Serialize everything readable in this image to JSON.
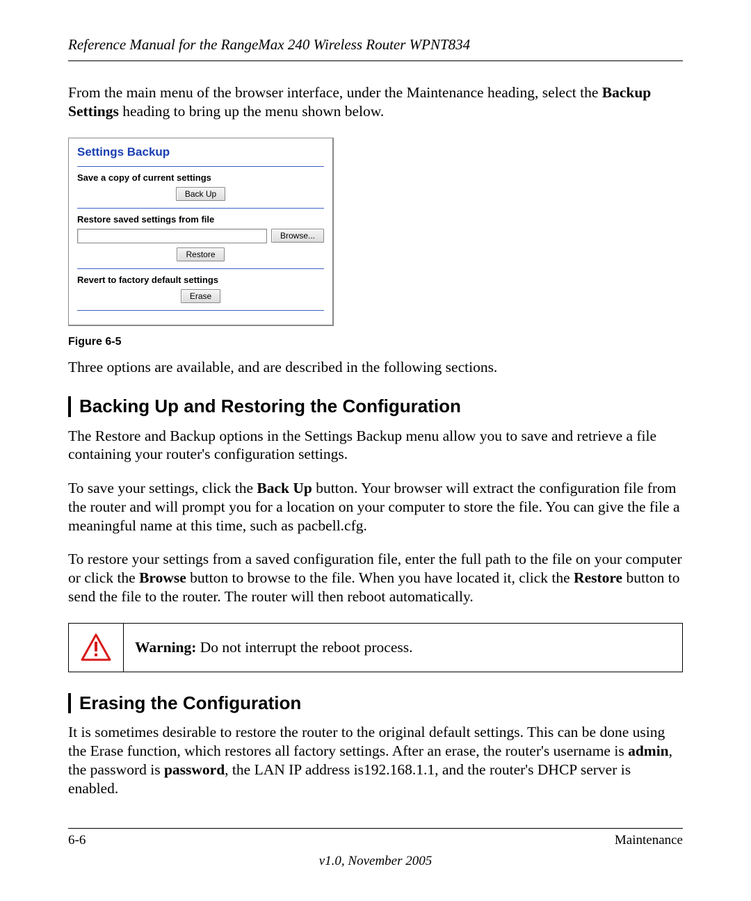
{
  "header": {
    "running_head": "Reference Manual for the RangeMax 240 Wireless Router WPNT834"
  },
  "intro": {
    "pre": "From the main menu of the browser interface, under the Maintenance heading, select the ",
    "bold1": "Backup Settings",
    "post": " heading to bring up the menu shown below."
  },
  "panel": {
    "title": "Settings Backup",
    "save_label": "Save a copy of current settings",
    "backup_btn": "Back Up",
    "restore_label": "Restore saved settings from file",
    "browse_btn": "Browse...",
    "restore_btn": "Restore",
    "revert_label": "Revert to factory default settings",
    "erase_btn": "Erase",
    "file_value": ""
  },
  "figure_label": "Figure 6-5",
  "after_figure": "Three options are available, and are described in the following sections.",
  "section1": {
    "title": "Backing Up and Restoring the Configuration",
    "p1": "The Restore and Backup options in the Settings Backup menu allow you to save and retrieve a file containing your router's configuration settings.",
    "p2_a": "To save your settings, click the ",
    "p2_bold": "Back Up",
    "p2_b": " button. Your browser will extract the configuration file from the router and will prompt you for a location on your computer to store the file. You can give the file a meaningful name at this time, such as pacbell.cfg.",
    "p3_a": "To restore your settings from a saved configuration file, enter the full path to the file on your computer or click the ",
    "p3_bold1": "Browse",
    "p3_b": " button to browse to the file. When you have located it, click the ",
    "p3_bold2": "Restore",
    "p3_c": " button to send the file to the router. The router will then reboot automatically."
  },
  "warning": {
    "label": "Warning:",
    "text": " Do not interrupt the reboot process."
  },
  "section2": {
    "title": "Erasing the Configuration",
    "p1_a": "It is sometimes desirable to restore the router to the original default settings. This can be done using the Erase function, which restores all factory settings. After an erase, the router's username is ",
    "p1_bold1": "admin",
    "p1_b": ", the password is ",
    "p1_bold2": "password",
    "p1_c": ", the LAN IP address is192.168.1.1, and the router's DHCP server is enabled."
  },
  "footer": {
    "page": "6-6",
    "chapter": "Maintenance",
    "version": "v1.0, November 2005"
  }
}
